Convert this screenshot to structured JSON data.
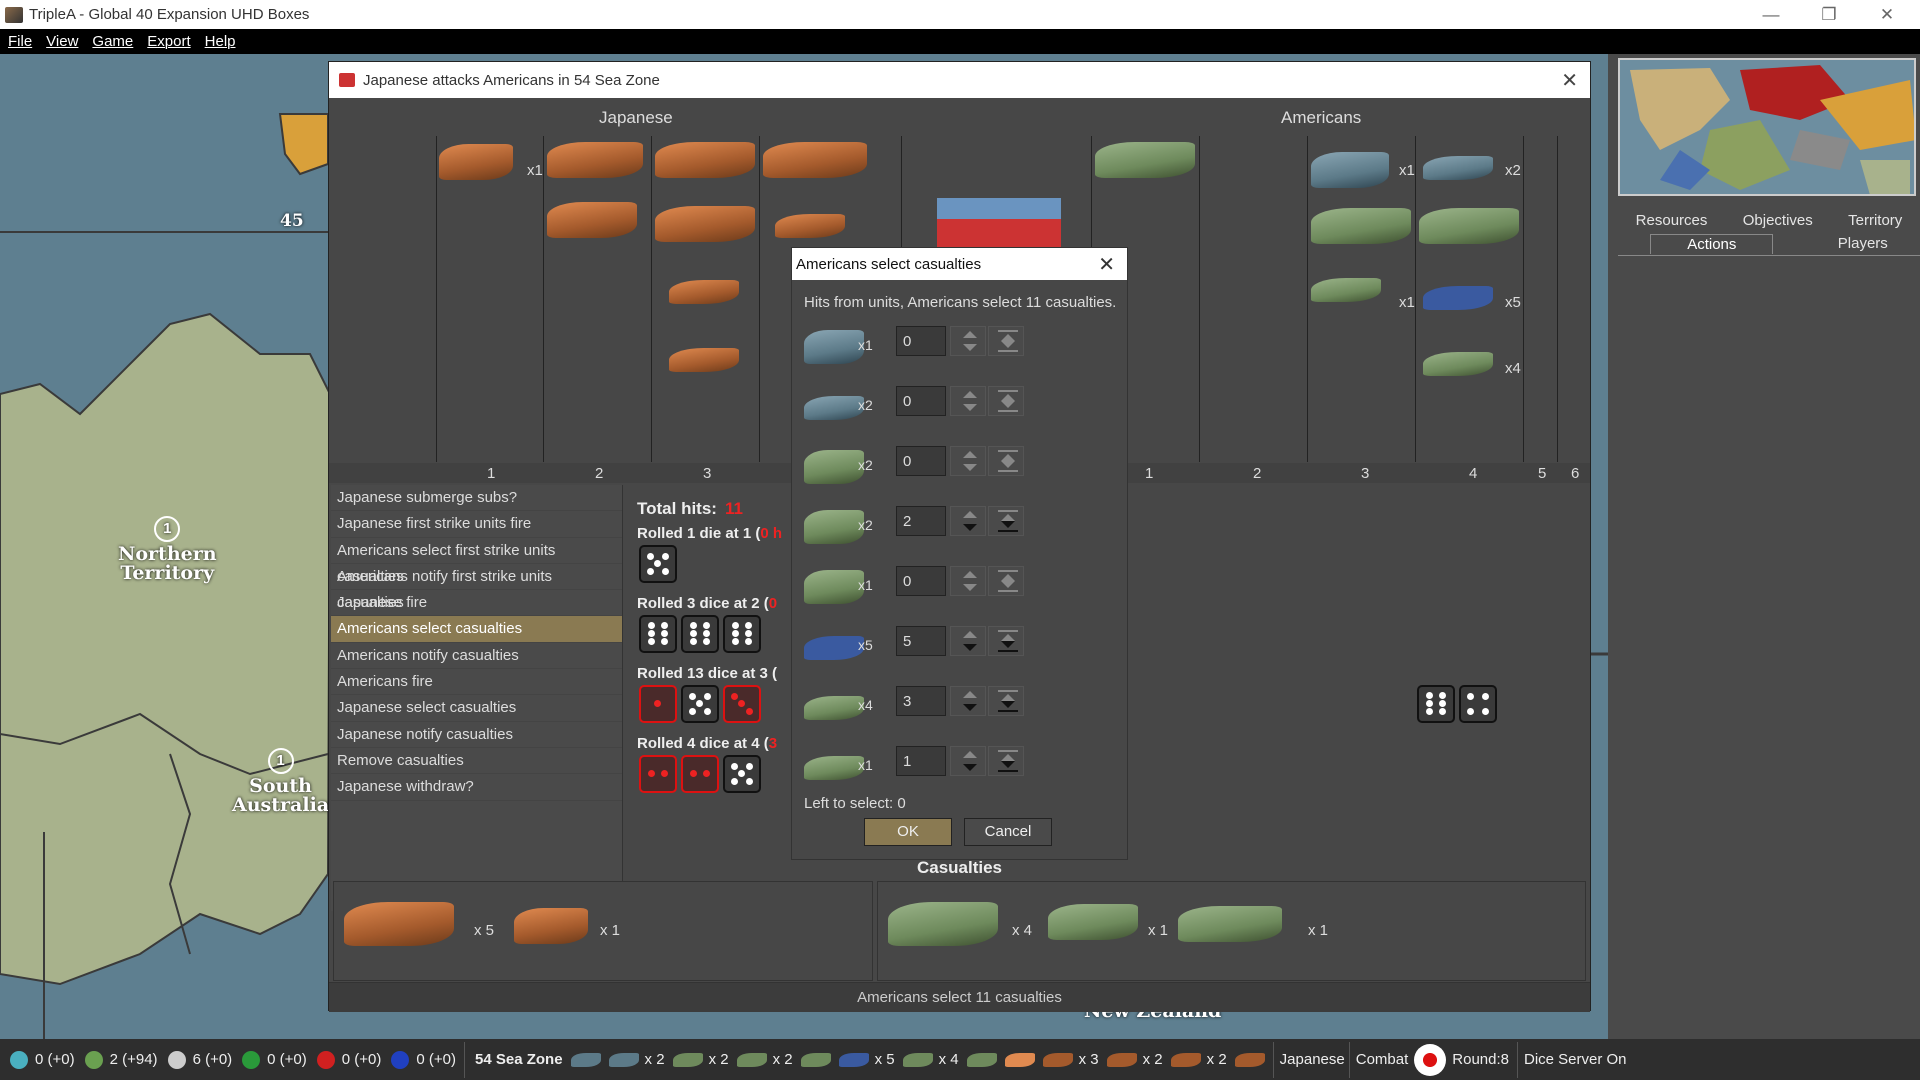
{
  "window": {
    "title": "TripleA - Global 40 Expansion UHD Boxes",
    "min": "—",
    "max": "❐",
    "close": "✕"
  },
  "menu": [
    "File",
    "View",
    "Game",
    "Export",
    "Help"
  ],
  "map": {
    "label_45": "45",
    "territories": [
      {
        "name": "Northern Territory",
        "line1": "Northern",
        "line2": "Territory",
        "value": "1"
      },
      {
        "name": "South Australia",
        "line1": "South",
        "line2": "Australia",
        "value": "1"
      },
      {
        "name": "New Zealand",
        "line1": "New Zealand"
      }
    ]
  },
  "side": {
    "tabs_row1": [
      "Resources",
      "Objectives",
      "Territory"
    ],
    "tabs_row2": [
      "Actions",
      "Players"
    ]
  },
  "battle": {
    "title": "Japanese attacks Americans in 54 Sea Zone",
    "attacker": "Japanese",
    "defender": "Americans",
    "attacker_cols": [
      "1",
      "2",
      "3",
      "4"
    ],
    "defender_cols": [
      "1",
      "2",
      "3",
      "4",
      "5",
      "6"
    ],
    "attacker_mults": [
      "x1"
    ],
    "defender_mults": [
      "x1",
      "x2",
      "x1",
      "x5",
      "x4"
    ],
    "steps": [
      "Japanese submerge subs?",
      "Japanese first strike units fire",
      "Americans select first strike units casualties",
      "Americans notify first strike units casualties",
      "Japanese fire",
      "Americans select casualties",
      "Americans notify casualties",
      "Americans fire",
      "Japanese select casualties",
      "Japanese notify casualties",
      "Remove casualties",
      "Japanese withdraw?"
    ],
    "selected_step": 5,
    "total_hits_label": "Total hits:",
    "total_hits": "11",
    "rolls": [
      {
        "label": "Rolled 1 die at 1 (",
        "hits": "0 h"
      },
      {
        "label": "Rolled 3 dice at 2 (",
        "hits": "0"
      },
      {
        "label": "Rolled 13 dice at 3 (",
        "hits": ""
      },
      {
        "label": "Rolled 4 dice at 4 (",
        "hits": "3"
      }
    ],
    "casualties_label": "Casualties",
    "casualty_mults": [
      "x 5",
      "x 1",
      "x 4",
      "x 1",
      "x 1"
    ],
    "status": "Americans select 11 casualties"
  },
  "dialog": {
    "title": "Americans select casualties",
    "info": "Hits from units,  Americans select 11 casualties.",
    "rows": [
      {
        "unit": "submarine",
        "mult": "x1",
        "value": "0"
      },
      {
        "unit": "fighter",
        "mult": "x2",
        "value": "0"
      },
      {
        "unit": "destroyer",
        "mult": "x2",
        "value": "0"
      },
      {
        "unit": "cruiser",
        "mult": "x2",
        "value": "2"
      },
      {
        "unit": "battleship-damaged",
        "mult": "x1",
        "value": "0"
      },
      {
        "unit": "tactical-bomber",
        "mult": "x5",
        "value": "5"
      },
      {
        "unit": "fighter-green",
        "mult": "x4",
        "value": "3"
      },
      {
        "unit": "fighter-green-2",
        "mult": "x1",
        "value": "1"
      }
    ],
    "left_to_select": "Left to select: 0",
    "ok": "OK",
    "cancel": "Cancel"
  },
  "bottombar": {
    "resources": [
      {
        "icon": "pus-icon",
        "value": "0 (+0)",
        "color": "#4ab0c0"
      },
      {
        "icon": "money-icon",
        "value": "2 (+94)",
        "color": "#6aa050"
      },
      {
        "icon": "skull-icon",
        "value": "6 (+0)",
        "color": "#cccccc"
      },
      {
        "icon": "tech-icon",
        "value": "0 (+0)",
        "color": "#2a9a3a"
      },
      {
        "icon": "red-token-icon",
        "value": "0 (+0)",
        "color": "#d02020"
      },
      {
        "icon": "blue-token-icon",
        "value": "0 (+0)",
        "color": "#2040c0"
      }
    ],
    "territory": "54 Sea Zone",
    "unit_mults": [
      "x 2",
      "x 2",
      "x 2",
      "x 5",
      "x 4",
      "x 3",
      "x 2",
      "x 2"
    ],
    "player": "Japanese",
    "phase": "Combat",
    "round": "Round:8",
    "dice": "Dice Server On"
  }
}
